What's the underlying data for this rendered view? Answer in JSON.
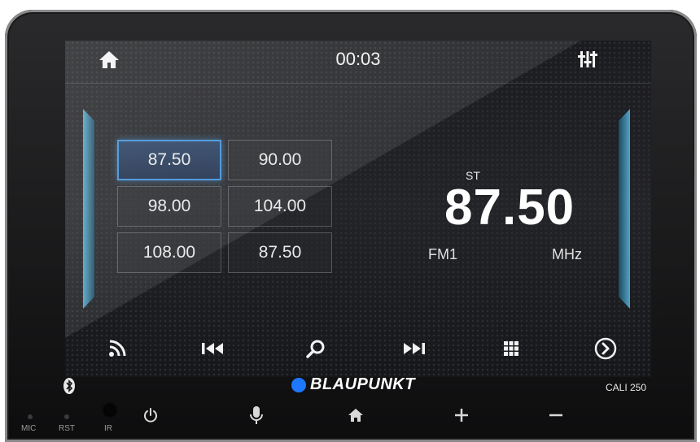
{
  "status_bar": {
    "time": "00:03"
  },
  "presets": [
    {
      "label": "87.50",
      "active": true
    },
    {
      "label": "90.00",
      "active": false
    },
    {
      "label": "98.00",
      "active": false
    },
    {
      "label": "104.00",
      "active": false
    },
    {
      "label": "108.00",
      "active": false
    },
    {
      "label": "87.50",
      "active": false
    }
  ],
  "tuner": {
    "stereo": "ST",
    "frequency": "87.50",
    "band": "FM1",
    "unit": "MHz"
  },
  "controls": [
    "rss-icon",
    "previous-track-icon",
    "search-icon",
    "next-track-icon",
    "grid-menu-icon",
    "arrow-right-circle-icon"
  ],
  "device": {
    "brand": "BLAUPUNKT",
    "model": "CALI 250",
    "labels": {
      "mic": "MIC",
      "rst": "RST",
      "ir": "IR"
    },
    "accent_color": "#1e78ff"
  },
  "colors": {
    "preset_active_border": "#3f8fd6",
    "side_glow": "#5ab3d8"
  }
}
